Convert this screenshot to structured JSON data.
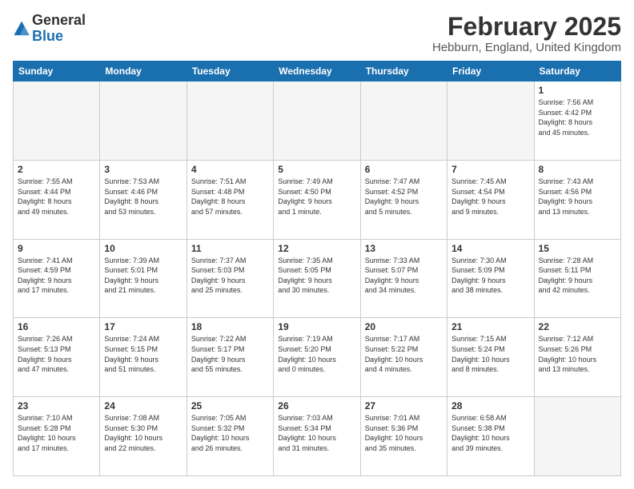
{
  "header": {
    "logo_line1": "General",
    "logo_line2": "Blue",
    "title": "February 2025",
    "subtitle": "Hebburn, England, United Kingdom"
  },
  "weekdays": [
    "Sunday",
    "Monday",
    "Tuesday",
    "Wednesday",
    "Thursday",
    "Friday",
    "Saturday"
  ],
  "weeks": [
    [
      {
        "day": "",
        "info": ""
      },
      {
        "day": "",
        "info": ""
      },
      {
        "day": "",
        "info": ""
      },
      {
        "day": "",
        "info": ""
      },
      {
        "day": "",
        "info": ""
      },
      {
        "day": "",
        "info": ""
      },
      {
        "day": "1",
        "info": "Sunrise: 7:56 AM\nSunset: 4:42 PM\nDaylight: 8 hours\nand 45 minutes."
      }
    ],
    [
      {
        "day": "2",
        "info": "Sunrise: 7:55 AM\nSunset: 4:44 PM\nDaylight: 8 hours\nand 49 minutes."
      },
      {
        "day": "3",
        "info": "Sunrise: 7:53 AM\nSunset: 4:46 PM\nDaylight: 8 hours\nand 53 minutes."
      },
      {
        "day": "4",
        "info": "Sunrise: 7:51 AM\nSunset: 4:48 PM\nDaylight: 8 hours\nand 57 minutes."
      },
      {
        "day": "5",
        "info": "Sunrise: 7:49 AM\nSunset: 4:50 PM\nDaylight: 9 hours\nand 1 minute."
      },
      {
        "day": "6",
        "info": "Sunrise: 7:47 AM\nSunset: 4:52 PM\nDaylight: 9 hours\nand 5 minutes."
      },
      {
        "day": "7",
        "info": "Sunrise: 7:45 AM\nSunset: 4:54 PM\nDaylight: 9 hours\nand 9 minutes."
      },
      {
        "day": "8",
        "info": "Sunrise: 7:43 AM\nSunset: 4:56 PM\nDaylight: 9 hours\nand 13 minutes."
      }
    ],
    [
      {
        "day": "9",
        "info": "Sunrise: 7:41 AM\nSunset: 4:59 PM\nDaylight: 9 hours\nand 17 minutes."
      },
      {
        "day": "10",
        "info": "Sunrise: 7:39 AM\nSunset: 5:01 PM\nDaylight: 9 hours\nand 21 minutes."
      },
      {
        "day": "11",
        "info": "Sunrise: 7:37 AM\nSunset: 5:03 PM\nDaylight: 9 hours\nand 25 minutes."
      },
      {
        "day": "12",
        "info": "Sunrise: 7:35 AM\nSunset: 5:05 PM\nDaylight: 9 hours\nand 30 minutes."
      },
      {
        "day": "13",
        "info": "Sunrise: 7:33 AM\nSunset: 5:07 PM\nDaylight: 9 hours\nand 34 minutes."
      },
      {
        "day": "14",
        "info": "Sunrise: 7:30 AM\nSunset: 5:09 PM\nDaylight: 9 hours\nand 38 minutes."
      },
      {
        "day": "15",
        "info": "Sunrise: 7:28 AM\nSunset: 5:11 PM\nDaylight: 9 hours\nand 42 minutes."
      }
    ],
    [
      {
        "day": "16",
        "info": "Sunrise: 7:26 AM\nSunset: 5:13 PM\nDaylight: 9 hours\nand 47 minutes."
      },
      {
        "day": "17",
        "info": "Sunrise: 7:24 AM\nSunset: 5:15 PM\nDaylight: 9 hours\nand 51 minutes."
      },
      {
        "day": "18",
        "info": "Sunrise: 7:22 AM\nSunset: 5:17 PM\nDaylight: 9 hours\nand 55 minutes."
      },
      {
        "day": "19",
        "info": "Sunrise: 7:19 AM\nSunset: 5:20 PM\nDaylight: 10 hours\nand 0 minutes."
      },
      {
        "day": "20",
        "info": "Sunrise: 7:17 AM\nSunset: 5:22 PM\nDaylight: 10 hours\nand 4 minutes."
      },
      {
        "day": "21",
        "info": "Sunrise: 7:15 AM\nSunset: 5:24 PM\nDaylight: 10 hours\nand 8 minutes."
      },
      {
        "day": "22",
        "info": "Sunrise: 7:12 AM\nSunset: 5:26 PM\nDaylight: 10 hours\nand 13 minutes."
      }
    ],
    [
      {
        "day": "23",
        "info": "Sunrise: 7:10 AM\nSunset: 5:28 PM\nDaylight: 10 hours\nand 17 minutes."
      },
      {
        "day": "24",
        "info": "Sunrise: 7:08 AM\nSunset: 5:30 PM\nDaylight: 10 hours\nand 22 minutes."
      },
      {
        "day": "25",
        "info": "Sunrise: 7:05 AM\nSunset: 5:32 PM\nDaylight: 10 hours\nand 26 minutes."
      },
      {
        "day": "26",
        "info": "Sunrise: 7:03 AM\nSunset: 5:34 PM\nDaylight: 10 hours\nand 31 minutes."
      },
      {
        "day": "27",
        "info": "Sunrise: 7:01 AM\nSunset: 5:36 PM\nDaylight: 10 hours\nand 35 minutes."
      },
      {
        "day": "28",
        "info": "Sunrise: 6:58 AM\nSunset: 5:38 PM\nDaylight: 10 hours\nand 39 minutes."
      },
      {
        "day": "",
        "info": ""
      }
    ]
  ]
}
